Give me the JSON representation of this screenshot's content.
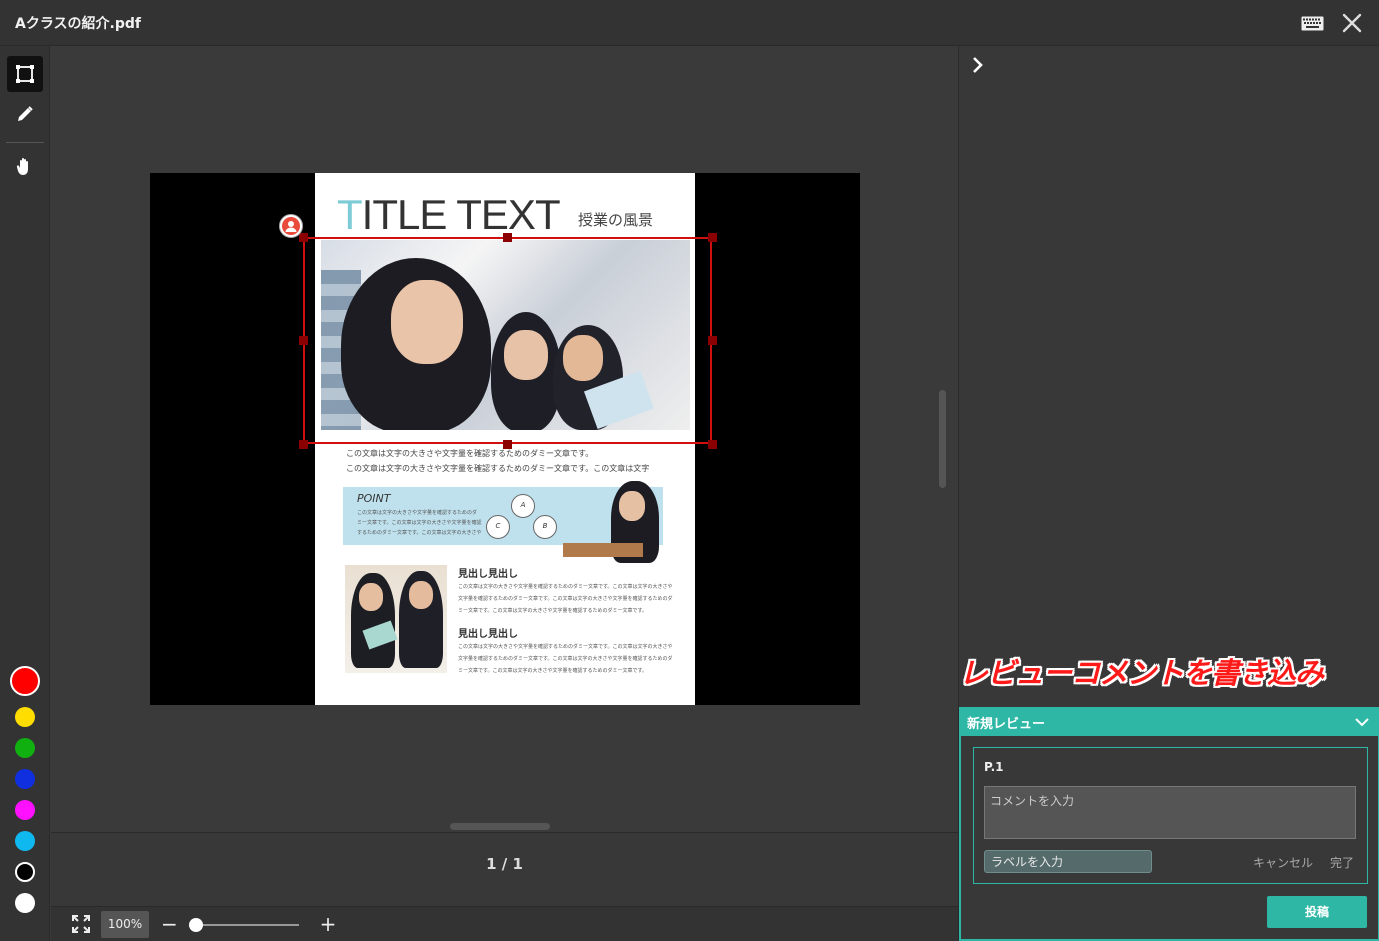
{
  "window": {
    "title": "Aクラスの紹介.pdf"
  },
  "toolbar": {
    "tools": [
      "rectangle-tool",
      "pen-tool",
      "hand-tool"
    ],
    "colors": [
      "#ff0000",
      "#ffdd00",
      "#10b010",
      "#1030e0",
      "#ff10ff",
      "#10b8f0",
      "#000000",
      "#ffffff"
    ],
    "selected_color": "#ff0000"
  },
  "document": {
    "title_first": "T",
    "title_rest": "ITLE TEXT",
    "subtitle": "授業の風景",
    "body_line1": "この文章は文字の大きさや文字量を確認するためのダミー文章です。",
    "body_line2": "この文章は文字の大きさや文字量を確認するためのダミー文章です。この文章は文字",
    "point_label": "POINT",
    "point_line1": "この文章は文字の大きさや文字量を確認するためのダ",
    "point_line2": "ミー文章です。この文章は文字の大きさや文字量を確認",
    "point_line3": "するためのダミー文章です。この文章は文字の大きさや",
    "circle_a": "A",
    "circle_b": "B",
    "circle_c": "C",
    "heading1": "見出し見出し",
    "heading2": "見出し見出し",
    "side_line1": "この文章は文字の大きさや文字量を確認するためのダミー文章です。この文章は文字の大きさや",
    "side_line2": "文字量を確認するためのダミー文章です。この文章は文字の大きさや文字量を確認するためのダ",
    "side_line3": "ミー文章です。この文章は文字の大きさや文字量を確認するためのダミー文章です。"
  },
  "pagination": {
    "indicator": "1 / 1"
  },
  "zoom": {
    "value": "100%",
    "minus": "−",
    "plus": "+",
    "level_fraction": 0.0
  },
  "annotation_text": "レビューコメントを書き込み",
  "review": {
    "header": "新規レビュー",
    "page_label": "P.1",
    "comment_placeholder": "コメントを入力",
    "label_placeholder": "ラベルを入力",
    "cancel": "キャンセル",
    "done": "完了",
    "post": "投稿"
  }
}
